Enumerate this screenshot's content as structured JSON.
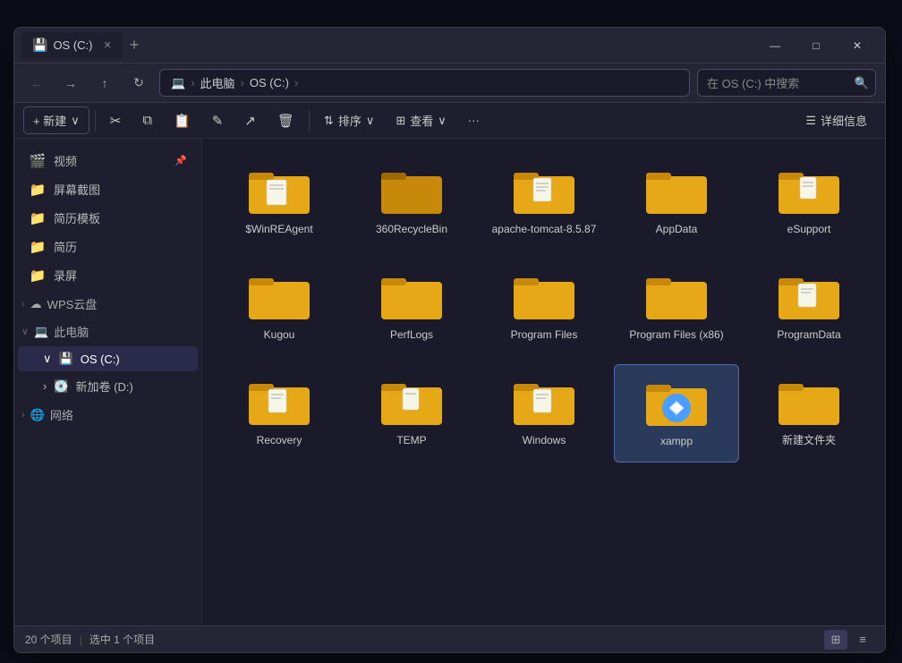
{
  "window": {
    "title": "OS (C:)",
    "tab_icon": "💾",
    "close_label": "✕",
    "add_tab": "+",
    "minimize": "—",
    "maximize": "□",
    "close": "✕"
  },
  "address": {
    "computer_icon": "💻",
    "path": [
      "此电脑",
      "OS (C:)"
    ],
    "search_placeholder": "在 OS (C:) 中搜索"
  },
  "toolbar": {
    "new_label": "+ 新建",
    "new_chevron": "∨",
    "cut_icon": "✂",
    "copy_icon": "⧉",
    "paste_icon": "📋",
    "rename_icon": "✎",
    "share_icon": "↗",
    "delete_icon": "🗑",
    "sort_label": "排序",
    "view_label": "查看",
    "more_icon": "···",
    "detail_icon": "≡",
    "detail_label": "详细信息"
  },
  "sidebar": {
    "items": [
      {
        "id": "videos",
        "icon": "🎬",
        "label": "视频",
        "pinned": true
      },
      {
        "id": "screenshots",
        "icon": "📁",
        "label": "屏幕截图",
        "pinned": false
      },
      {
        "id": "resume-templates",
        "icon": "📁",
        "label": "简历模板",
        "pinned": false
      },
      {
        "id": "resume",
        "icon": "📁",
        "label": "简历",
        "pinned": false
      },
      {
        "id": "recordings",
        "icon": "📁",
        "label": "录屏",
        "pinned": false
      }
    ],
    "groups": [
      {
        "id": "wps",
        "icon": "☁",
        "label": "WPS云盘",
        "expanded": false
      },
      {
        "id": "my-computer",
        "icon": "💻",
        "label": "此电脑",
        "expanded": true
      },
      {
        "id": "os-c",
        "icon": "💾",
        "label": "OS (C:)",
        "active": true,
        "child": true
      },
      {
        "id": "new-d",
        "icon": "💽",
        "label": "新加卷 (D:)",
        "child": true
      },
      {
        "id": "network",
        "icon": "🌐",
        "label": "网络",
        "expanded": false
      }
    ]
  },
  "files": [
    {
      "id": "winreagent",
      "label": "$WinREAgent",
      "type": "folder",
      "has_doc": true
    },
    {
      "id": "360recyclebin",
      "label": "360RecycleBin",
      "type": "folder",
      "style": "dark"
    },
    {
      "id": "apache-tomcat",
      "label": "apache-tomcat-8.5.87",
      "type": "folder",
      "has_doc": true
    },
    {
      "id": "appdata",
      "label": "AppData",
      "type": "folder"
    },
    {
      "id": "esupport",
      "label": "eSupport",
      "type": "folder",
      "has_doc": true
    },
    {
      "id": "kugou",
      "label": "Kugou",
      "type": "folder"
    },
    {
      "id": "perflogs",
      "label": "PerfLogs",
      "type": "folder"
    },
    {
      "id": "program-files",
      "label": "Program Files",
      "type": "folder"
    },
    {
      "id": "program-files-x86",
      "label": "Program Files (x86)",
      "type": "folder"
    },
    {
      "id": "programdata",
      "label": "ProgramData",
      "type": "folder",
      "has_doc": true
    },
    {
      "id": "recovery",
      "label": "Recovery",
      "type": "folder",
      "has_doc": true
    },
    {
      "id": "temp",
      "label": "TEMP",
      "type": "folder",
      "has_doc": true
    },
    {
      "id": "windows",
      "label": "Windows",
      "type": "folder",
      "has_doc": true
    },
    {
      "id": "xampp",
      "label": "xampp",
      "type": "folder_special",
      "selected": true
    },
    {
      "id": "new-folder",
      "label": "新建文件夹",
      "type": "folder"
    }
  ],
  "statusbar": {
    "count": "20 个项目",
    "separator": "|",
    "selected": "选中 1 个项目"
  },
  "colors": {
    "folder_body": "#e6a817",
    "folder_dark": "#c8880a",
    "folder_back": "#c8880a",
    "selected_bg": "#2a3a5a",
    "accent": "#4a9eff"
  }
}
